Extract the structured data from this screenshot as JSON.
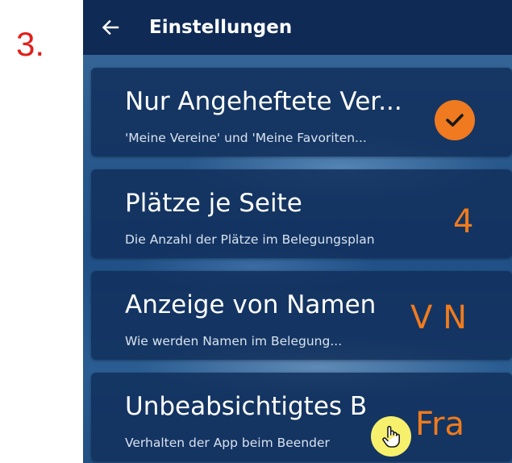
{
  "step_label": "3.",
  "appbar": {
    "back_icon": "arrow-left-icon",
    "title": "Einstellungen"
  },
  "settings": [
    {
      "title": "Nur Angeheftete Ver...",
      "subtitle": "'Meine Vereine' und 'Meine Favoriten...",
      "value_type": "check",
      "checked": true,
      "value_icon": "check-circle-icon"
    },
    {
      "title": "Plätze je Seite",
      "subtitle": "Die Anzahl der Plätze im Belegungsplan",
      "value_type": "text",
      "value": "4"
    },
    {
      "title": "Anzeige von Namen",
      "subtitle": "Wie werden Namen im Belegung...",
      "value_type": "text",
      "value": "V N"
    },
    {
      "title": "Unbeabsichtigtes B",
      "subtitle": "Verhalten der App beim Beender",
      "value_type": "text",
      "value": "Fra"
    }
  ],
  "cursor_icon": "hand-pointer-icon",
  "colors": {
    "appbar": "#0f2a55",
    "card": "#12305c",
    "accent": "#ef7a20",
    "step_label": "#e0201c",
    "cursor_highlight": "#f7f06c"
  }
}
